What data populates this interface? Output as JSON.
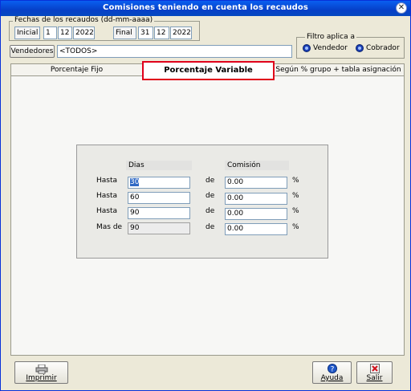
{
  "window": {
    "title": "Comisiones teniendo en cuenta los recaudos",
    "close_glyph": "✕"
  },
  "dates": {
    "group_label": "Fechas de los recaudos (dd-mm-aaaa)",
    "start_label": "Inicial",
    "start_day": "1",
    "start_month": "12",
    "start_year": "2022",
    "end_label": "Final",
    "end_day": "31",
    "end_month": "12",
    "end_year": "2022"
  },
  "filter": {
    "group_label": "Filtro aplica a",
    "option1": "Vendedor",
    "option2": "Cobrador",
    "selected": "Cobrador"
  },
  "sellers": {
    "button_label": "Vendedores",
    "value": "<TODOS>"
  },
  "tabs": [
    {
      "label": "Porcentaje Fijo"
    },
    {
      "label": "Porcentaje Variable"
    },
    {
      "label": "Según % grupo + tabla asignación"
    }
  ],
  "table": {
    "col_days": "Dias",
    "col_commission": "Comisión",
    "rows": [
      {
        "label": "Hasta",
        "days": "30",
        "de": "de",
        "commission": "0.00",
        "pct": "%"
      },
      {
        "label": "Hasta",
        "days": "60",
        "de": "de",
        "commission": "0.00",
        "pct": "%"
      },
      {
        "label": "Hasta",
        "days": "90",
        "de": "de",
        "commission": "0.00",
        "pct": "%"
      },
      {
        "label": "Mas de",
        "days": "90",
        "de": "de",
        "commission": "0.00",
        "pct": "%"
      }
    ]
  },
  "buttons": {
    "print": "Imprimir",
    "help": "Ayuda",
    "exit": "Salir"
  },
  "icons": {
    "print": "printer-icon",
    "help": "help-icon",
    "exit": "exit-icon"
  }
}
